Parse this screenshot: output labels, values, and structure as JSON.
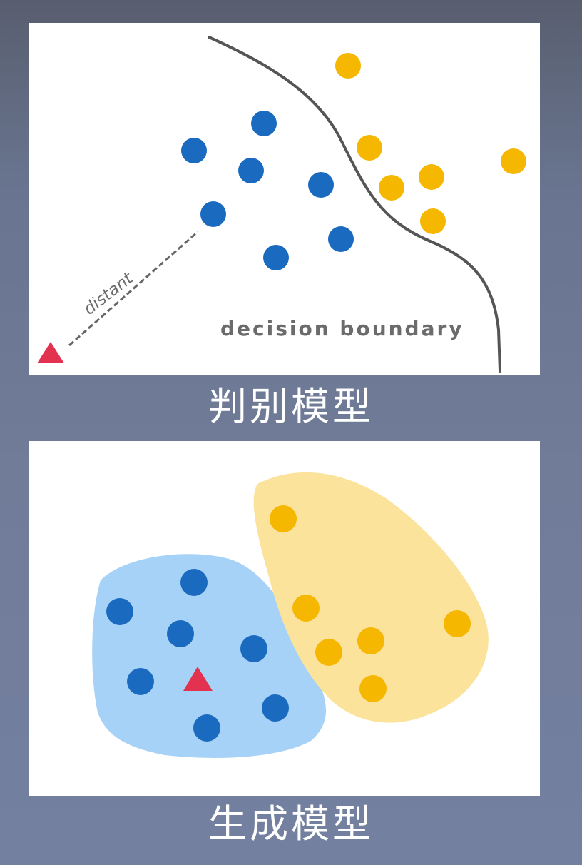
{
  "colors": {
    "class_a_point": "#1a6bbf",
    "class_b_point": "#f5b700",
    "class_a_region": "#a7d2f7",
    "class_b_region": "#fbe39c",
    "query_triangle": "#e3324f",
    "boundary_line": "#555555",
    "label_text": "#6b6b6b"
  },
  "discriminative": {
    "caption": "判别模型",
    "boundary_label": "decision boundary",
    "distance_label": "distant"
  },
  "generative": {
    "caption": "生成模型"
  }
}
